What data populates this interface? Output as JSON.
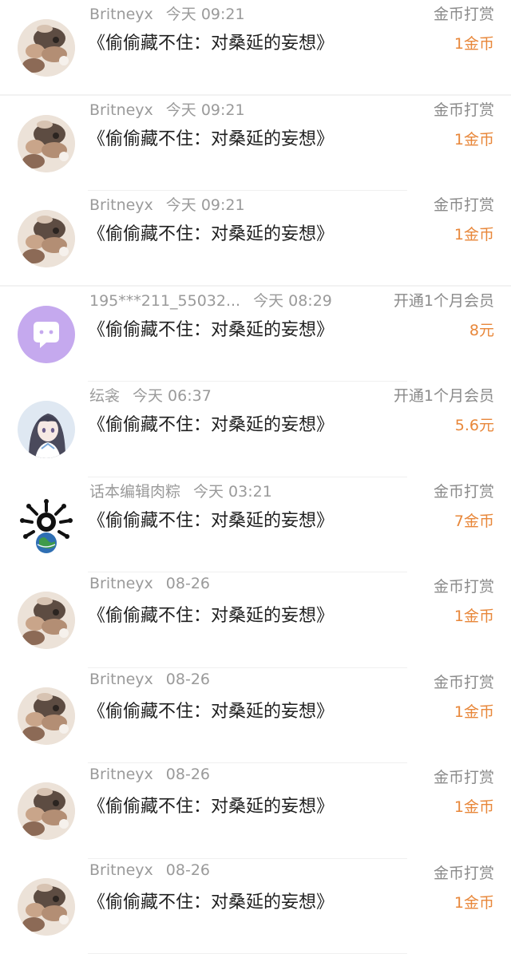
{
  "rows": [
    {
      "user": "Britneyx",
      "time": "今天 09:21",
      "title": "《偷偷藏不住：对桑延的妄想》",
      "type": "金币打赏",
      "amount": "1金币",
      "avatar": "cat-avatar-icon"
    },
    {
      "user": "Britneyx",
      "time": "今天 09:21",
      "title": "《偷偷藏不住：对桑延的妄想》",
      "type": "金币打赏",
      "amount": "1金币",
      "avatar": "cat-avatar-icon"
    },
    {
      "user": "Britneyx",
      "time": "今天 09:21",
      "title": "《偷偷藏不住：对桑延的妄想》",
      "type": "金币打赏",
      "amount": "1金币",
      "avatar": "cat-avatar-icon"
    },
    {
      "user": "195***211_55032...",
      "time": "今天 08:29",
      "title": "《偷偷藏不住：对桑延的妄想》",
      "type": "开通1个月会员",
      "amount": "8元",
      "avatar": "chat-bubble-avatar-icon"
    },
    {
      "user": "纭衾",
      "time": "今天 06:37",
      "title": "《偷偷藏不住：对桑延的妄想》",
      "type": "开通1个月会员",
      "amount": "5.6元",
      "avatar": "anime-girl-avatar-icon"
    },
    {
      "user": "话本编辑肉粽",
      "time": "今天 03:21",
      "title": "《偷偷藏不住：对桑延的妄想》",
      "type": "金币打赏",
      "amount": "7金币",
      "avatar": "globe-bones-avatar-icon"
    },
    {
      "user": "Britneyx",
      "time": "08-26",
      "title": "《偷偷藏不住：对桑延的妄想》",
      "type": "金币打赏",
      "amount": "1金币",
      "avatar": "cat-avatar-icon"
    },
    {
      "user": "Britneyx",
      "time": "08-26",
      "title": "《偷偷藏不住：对桑延的妄想》",
      "type": "金币打赏",
      "amount": "1金币",
      "avatar": "cat-avatar-icon"
    },
    {
      "user": "Britneyx",
      "time": "08-26",
      "title": "《偷偷藏不住：对桑延的妄想》",
      "type": "金币打赏",
      "amount": "1金币",
      "avatar": "cat-avatar-icon"
    },
    {
      "user": "Britneyx",
      "time": "08-26",
      "title": "《偷偷藏不住：对桑延的妄想》",
      "type": "金币打赏",
      "amount": "1金币",
      "avatar": "cat-avatar-icon"
    }
  ],
  "colors": {
    "amount": "#e8873a",
    "name": "#9a9a9a",
    "title": "#1f1f1f",
    "type": "#8a8a8a",
    "avatar_purple": "#c5a9ee"
  }
}
